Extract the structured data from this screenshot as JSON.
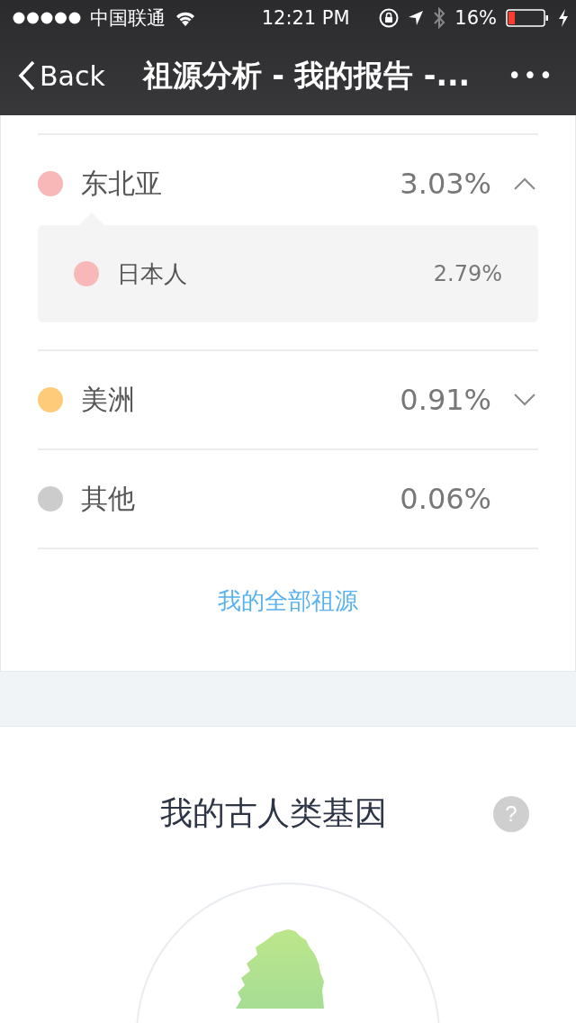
{
  "status_bar": {
    "carrier": "中国联通",
    "time": "12:21 PM",
    "battery": "16%"
  },
  "nav_bar": {
    "back": "Back",
    "title": "祖源分析 - 我的报告 -...",
    "more": "•••"
  },
  "regions": [
    {
      "name": "东北亚",
      "percent": "3.03%",
      "color": "#f9b8b8",
      "expanded": true,
      "children": [
        {
          "name": "日本人",
          "percent": "2.79%",
          "color": "#f9b8b8"
        }
      ]
    },
    {
      "name": "美洲",
      "percent": "0.91%",
      "color": "#fecb7a",
      "expanded": false
    },
    {
      "name": "其他",
      "percent": "0.06%",
      "color": "#cccccc"
    }
  ],
  "all_link": "我的全部祖源",
  "ancient": {
    "title": "我的古人类基因",
    "help": "?"
  }
}
